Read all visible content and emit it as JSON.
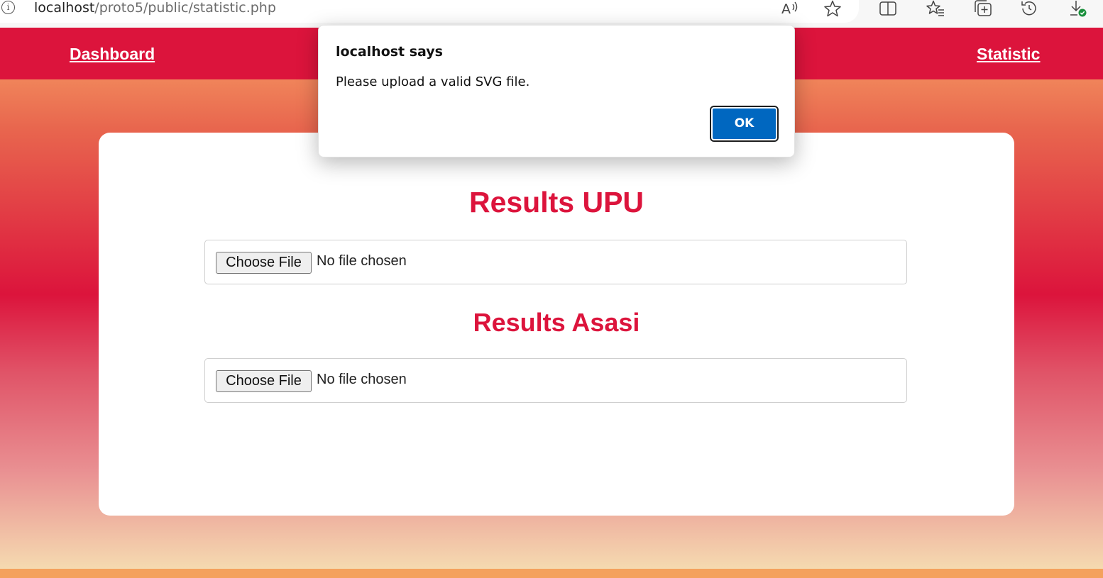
{
  "browser": {
    "url_host": "localhost",
    "url_path": "/proto5/public/statistic.php",
    "icons": [
      "info-icon",
      "read-aloud-icon",
      "favorite-star-icon",
      "split-screen-icon",
      "favorites-icon",
      "collections-icon",
      "history-icon",
      "downloads-icon"
    ]
  },
  "nav": {
    "dashboard": "Dashboard",
    "statistic": "Statistic",
    "color": "#dc143c"
  },
  "main": {
    "section1_title": "Results UPU",
    "section2_title": "Results Asasi",
    "file_button": "Choose File",
    "file_status": "No file chosen",
    "title_color": "#dc143c"
  },
  "dialog": {
    "title": "localhost says",
    "message": "Please upload a valid SVG file.",
    "ok": "OK",
    "button_color": "#0067c0"
  }
}
